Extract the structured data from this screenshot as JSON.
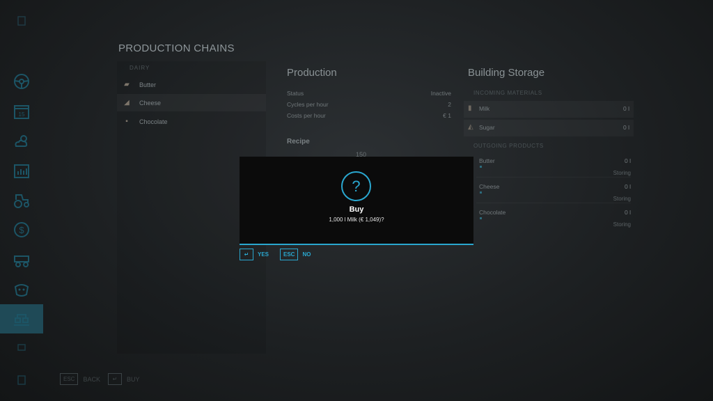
{
  "page": {
    "title": "PRODUCTION CHAINS"
  },
  "sidebar": {
    "items": [
      {
        "icon": "top-icon"
      },
      {
        "icon": "steering-wheel-icon"
      },
      {
        "icon": "calendar-icon",
        "label": "15"
      },
      {
        "icon": "weather-icon"
      },
      {
        "icon": "statistics-icon"
      },
      {
        "icon": "tractor-icon"
      },
      {
        "icon": "finance-icon",
        "label": "$"
      },
      {
        "icon": "vehicles-icon"
      },
      {
        "icon": "animals-icon"
      },
      {
        "icon": "production-icon",
        "active": true
      },
      {
        "icon": "settings-icon"
      },
      {
        "icon": "help-icon"
      }
    ]
  },
  "chains": {
    "header": "DAIRY",
    "items": [
      {
        "label": "Butter",
        "icon": "butter-icon"
      },
      {
        "label": "Cheese",
        "icon": "cheese-icon",
        "selected": true
      },
      {
        "label": "Chocolate",
        "icon": "chocolate-icon"
      }
    ]
  },
  "production": {
    "title": "Production",
    "rows": [
      {
        "label": "Status",
        "value": "Inactive"
      },
      {
        "label": "Cycles per hour",
        "value": "2"
      },
      {
        "label": "Costs per hour",
        "value": "€ 1"
      }
    ],
    "recipe_label": "Recipe",
    "recipe_amount": "150"
  },
  "storage": {
    "title": "Building Storage",
    "incoming_label": "INCOMING MATERIALS",
    "incoming": [
      {
        "name": "Milk",
        "value": "0 l",
        "icon": "milk-icon"
      },
      {
        "name": "Sugar",
        "value": "0 l",
        "icon": "sugar-icon"
      }
    ],
    "outgoing_label": "OUTGOING PRODUCTS",
    "outgoing": [
      {
        "name": "Butter",
        "value": "0 l",
        "mode": "Storing"
      },
      {
        "name": "Cheese",
        "value": "0 l",
        "mode": "Storing"
      },
      {
        "name": "Chocolate",
        "value": "0 l",
        "mode": "Storing"
      }
    ]
  },
  "footer": {
    "back_key": "ESC",
    "back_label": "BACK",
    "buy_key": "↵",
    "buy_label": "BUY"
  },
  "dialog": {
    "icon": "question-icon",
    "symbol": "?",
    "title": "Buy",
    "text": "1,000 l Milk (€ 1,049)?",
    "yes_key": "↵",
    "yes_label": "YES",
    "no_key": "ESC",
    "no_label": "NO",
    "accent": "#2aa7cf"
  }
}
